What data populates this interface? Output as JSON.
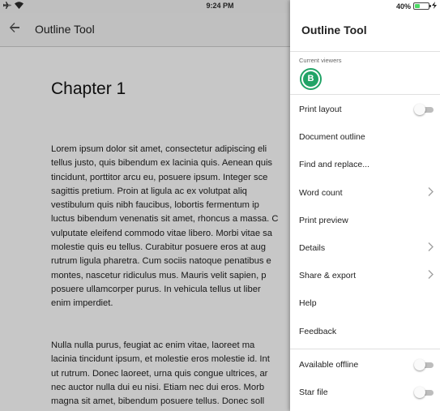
{
  "status_bar": {
    "time": "9:24 PM",
    "battery_text": "40%",
    "battery_level": 0.4
  },
  "toolbar": {
    "title": "Outline Tool"
  },
  "document": {
    "chapter_title": "Chapter 1",
    "paragraph1_lines": [
      "Lorem ipsum dolor sit amet, consectetur adipiscing eli",
      "tellus justo, quis bibendum ex lacinia quis. Aenean quis",
      "tincidunt, porttitor arcu eu, posuere ipsum. Integer sce",
      "sagittis pretium. Proin at ligula ac ex volutpat aliq",
      "vestibulum quis nibh faucibus, lobortis fermentum ip",
      "luctus bibendum venenatis sit amet, rhoncus a massa. C",
      "vulputate eleifend commodo vitae libero. Morbi vitae sa",
      "molestie quis eu tellus. Curabitur posuere eros at aug",
      "rutrum ligula pharetra. Cum sociis natoque penatibus e",
      "montes, nascetur ridiculus mus. Mauris velit sapien, p",
      "posuere ullamcorper purus. In vehicula tellus ut liber",
      "enim imperdiet."
    ],
    "paragraph2_lines": [
      "Nulla nulla purus, feugiat ac enim vitae, laoreet ma",
      "lacinia tincidunt ipsum, et molestie eros molestie id. Int",
      "ut rutrum. Donec laoreet, urna quis congue ultrices, ar",
      "nec auctor nulla dui eu nisi. Etiam nec dui eros. Morb",
      "magna sit amet, bibendum posuere tellus. Donec soll"
    ]
  },
  "drawer": {
    "title": "Outline Tool",
    "viewers_label": "Current viewers",
    "viewer_initial": "B",
    "viewer_color": "#21a366",
    "items": [
      {
        "label": "Print layout",
        "control": "toggle",
        "on": false
      },
      {
        "label": "Document outline",
        "control": "none"
      },
      {
        "label": "Find and replace...",
        "control": "none"
      },
      {
        "label": "Word count",
        "control": "chevron"
      },
      {
        "label": "Print preview",
        "control": "none"
      },
      {
        "label": "Details",
        "control": "chevron"
      },
      {
        "label": "Share & export",
        "control": "chevron"
      },
      {
        "label": "Help",
        "control": "none"
      },
      {
        "label": "Feedback",
        "control": "none"
      },
      {
        "label": "Available offline",
        "control": "toggle",
        "on": false
      },
      {
        "label": "Star file",
        "control": "toggle",
        "on": false
      }
    ]
  }
}
